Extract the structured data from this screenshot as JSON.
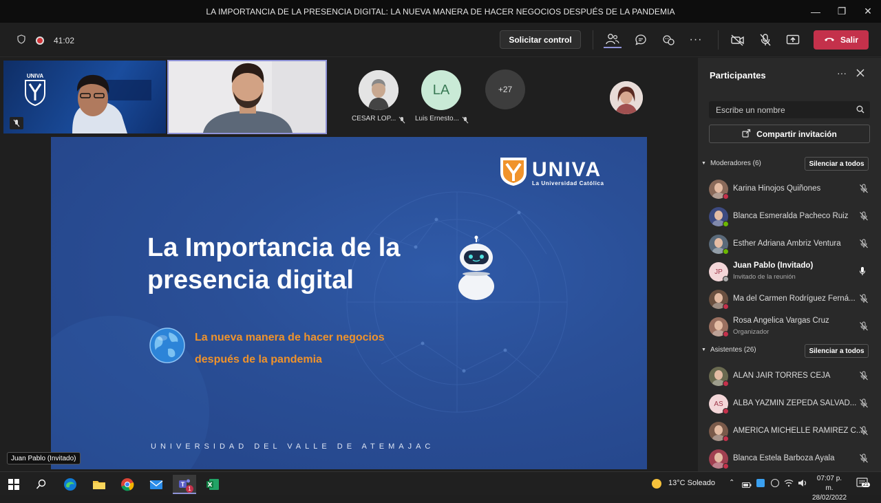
{
  "window": {
    "title": "LA IMPORTANCIA DE LA PRESENCIA DIGITAL: LA NUEVA MANERA DE HACER NEGOCIOS DESPUÉS DE LA PANDEMIA"
  },
  "toolbar": {
    "timer": "41:02",
    "request_control_label": "Solicitar control",
    "leave_label": "Salir"
  },
  "video_strip": {
    "tile1_logo": "UNIVA",
    "participants": [
      {
        "name": "CESAR LOP...",
        "initials": ""
      },
      {
        "name": "Luis Ernesto...",
        "initials": "LA"
      }
    ],
    "overflow_count": "+27"
  },
  "slide": {
    "brand": "UNIVA",
    "brand_tagline": "La Universidad Católica",
    "title_line1": "La Importancia de la",
    "title_line2": "presencia digital",
    "subtitle_line1": "La nueva manera de hacer negocios",
    "subtitle_line2": "después de la pandemia",
    "footer": "UNIVERSIDAD DEL VALLE DE ATEMAJAC"
  },
  "speaker_label": "Juan Pablo (Invitado)",
  "panel": {
    "title": "Participantes",
    "search_placeholder": "Escribe un nombre",
    "share_label": "Compartir invitación",
    "moderators_header": "Moderadores (6)",
    "attendees_header": "Asistentes (26)",
    "mute_all_label": "Silenciar a todos",
    "moderators": [
      {
        "name": "Karina Hinojos Quiñones",
        "sub": "",
        "status": "#c4314b",
        "avatar_color": "#8a6a5a"
      },
      {
        "name": "Blanca Esmeralda Pacheco Ruiz",
        "sub": "",
        "status": "#6bb700",
        "avatar_color": "#3d4a80"
      },
      {
        "name": "Esther Adriana Ambriz Ventura",
        "sub": "",
        "status": "#6bb700",
        "avatar_color": "#5a6a7a"
      },
      {
        "name": "Juan Pablo (Invitado)",
        "sub": "Invitado de la reunión",
        "status": "#aaaaaa",
        "avatar_color": "#f3d6d8",
        "initials": "JP"
      },
      {
        "name": "Ma del Carmen Rodríguez Ferná...",
        "sub": "",
        "status": "#c4314b",
        "avatar_color": "#6a5040"
      },
      {
        "name": "Rosa Angelica Vargas Cruz",
        "sub": "Organizador",
        "status": "#c4314b",
        "avatar_color": "#9a7060"
      }
    ],
    "attendees": [
      {
        "name": "ALAN JAIR TORRES CEJA",
        "status": "#c4314b",
        "avatar_color": "#6a6a50"
      },
      {
        "name": "ALBA YAZMIN ZEPEDA SALVAD...",
        "status": "#c4314b",
        "avatar_color": "#f3d6d8",
        "initials": "AS"
      },
      {
        "name": "AMERICA MICHELLE RAMIREZ C...",
        "status": "#c4314b",
        "avatar_color": "#7a5a4a"
      },
      {
        "name": "Blanca Estela Barboza Ayala",
        "status": "#c4314b",
        "avatar_color": "#a04050"
      }
    ]
  },
  "taskbar": {
    "weather": "13°C  Soleado",
    "time": "07:07 p. m.",
    "date": "28/02/2022",
    "notif_count": "21",
    "teams_badge": "1"
  },
  "colors": {
    "accent_red": "#c4314b",
    "slide_blue": "#2a4f97",
    "slide_orange": "#f0932b",
    "panel_bg": "#292929"
  }
}
